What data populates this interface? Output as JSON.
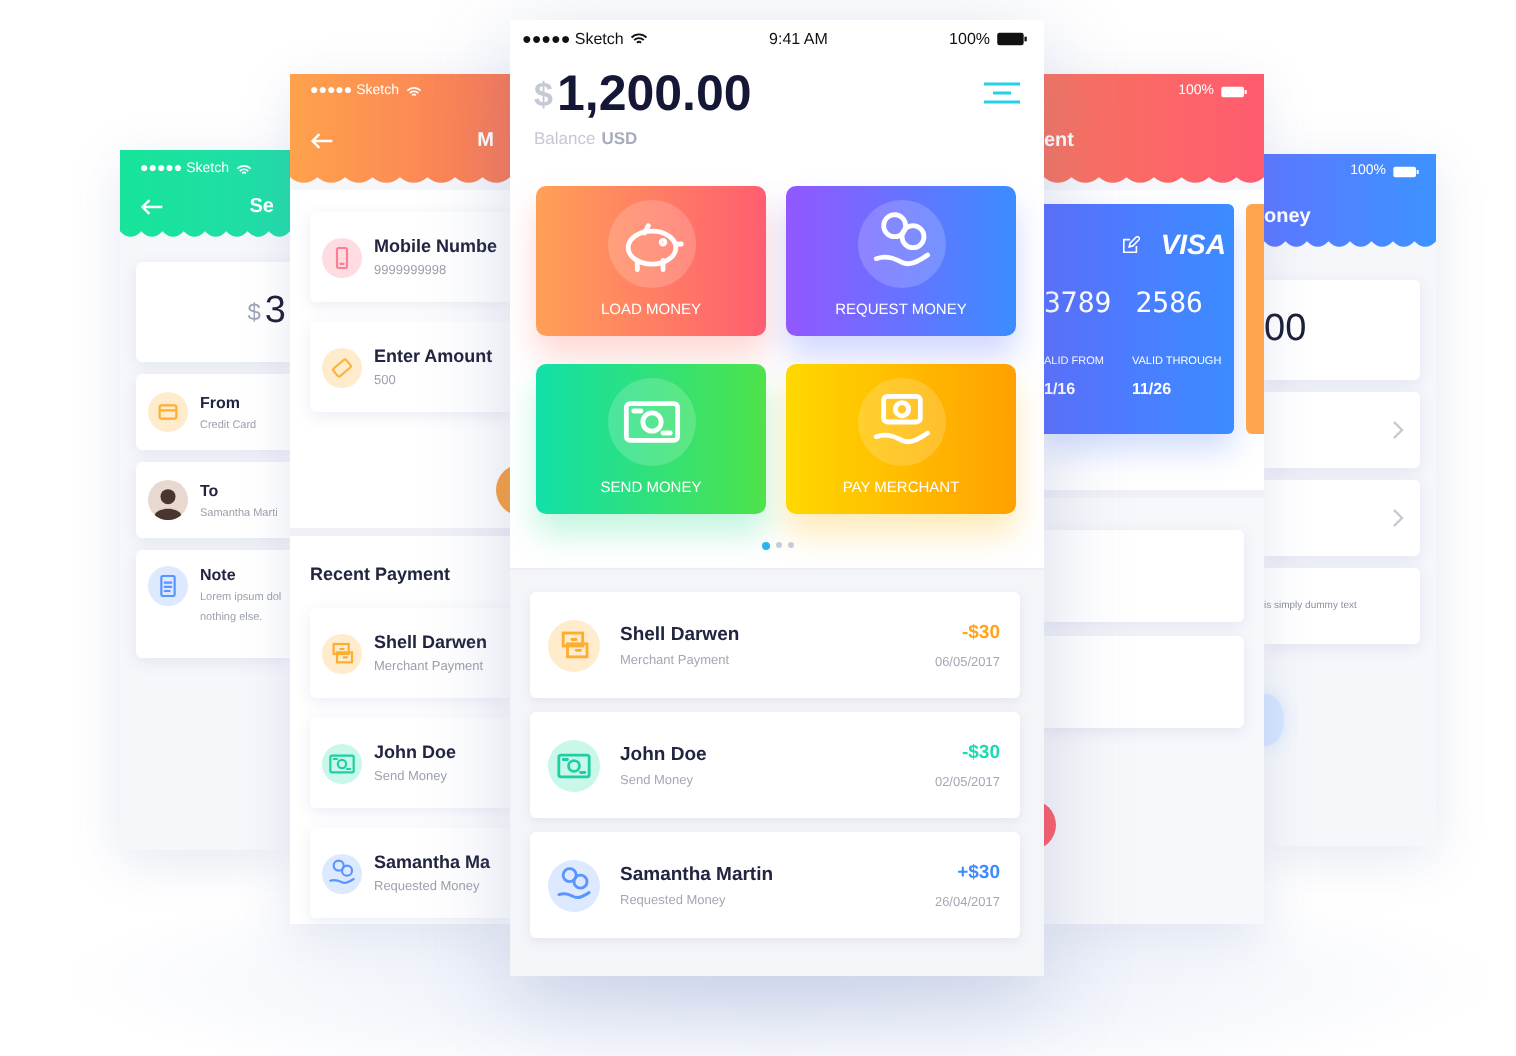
{
  "send_screen": {
    "carrier": "●●●●● Sketch",
    "title": "Se",
    "amount": {
      "currency": "$",
      "value": "3"
    },
    "fields": [
      {
        "kind": "card",
        "label": "From",
        "value": "Credit Card"
      },
      {
        "kind": "avatar",
        "label": "To",
        "value": "Samantha Marti"
      },
      {
        "kind": "note",
        "label": "Note",
        "lines": [
          "Lorem ipsum dol",
          "nothing else."
        ]
      }
    ]
  },
  "mobile_screen": {
    "carrier": "●●●●● Sketch",
    "title": "M",
    "fields": [
      {
        "kind": "phone",
        "label": "Mobile Numbe",
        "value": "9999999998"
      },
      {
        "kind": "ticket",
        "label": "Enter Amount",
        "value": "500"
      }
    ],
    "section_title": "Recent Payment",
    "payments": [
      {
        "kind": "merchant",
        "name": "Shell Darwen",
        "type": "Merchant Payment"
      },
      {
        "kind": "send",
        "name": "John Doe",
        "type": "Send Money"
      },
      {
        "kind": "request",
        "name": "Samantha Ma",
        "type": "Requested Money"
      }
    ]
  },
  "home_screen": {
    "status": {
      "carrier": "●●●●● Sketch",
      "time": "9:41 AM",
      "battery": "100%"
    },
    "balance": {
      "currency": "$",
      "amount": "1,200.00",
      "label": "Balance",
      "unit": "USD"
    },
    "actions": [
      {
        "kind": "load",
        "label": "LOAD MONEY"
      },
      {
        "kind": "request",
        "label": "REQUEST MONEY"
      },
      {
        "kind": "send",
        "label": "SEND MONEY"
      },
      {
        "kind": "pay",
        "label": "PAY MERCHANT"
      }
    ],
    "pages": [
      {
        "selected": true
      },
      {
        "selected": false
      },
      {
        "selected": false
      }
    ],
    "transactions": [
      {
        "kind": "merchant",
        "name": "Shell Darwen",
        "type": "Merchant Payment",
        "amount": "-$30",
        "date": "06/05/2017",
        "color": "#ffa41b"
      },
      {
        "kind": "send",
        "name": "John Doe",
        "type": "Send Money",
        "amount": "-$30",
        "date": "02/05/2017",
        "color": "#1fd9b0"
      },
      {
        "kind": "request",
        "name": "Samantha Martin",
        "type": "Requested Money",
        "amount": "+$30",
        "date": "26/04/2017",
        "color": "#3d8bff"
      }
    ]
  },
  "card_screen": {
    "battery": "100%",
    "title": "ent",
    "card": {
      "brand": "VISA",
      "number": [
        "3789",
        "2586"
      ],
      "valid_from_label": "ALID FROM",
      "valid_from": "1/16",
      "valid_through_label": "VALID THROUGH",
      "valid_through": "11/26"
    }
  },
  "request_screen": {
    "battery": "100%",
    "title": "oney",
    "amount": "00",
    "rows": [
      {
        "kind": "chevron"
      },
      {
        "kind": "chevron"
      },
      {
        "kind": "text",
        "text": "is simply dummy text"
      }
    ]
  }
}
